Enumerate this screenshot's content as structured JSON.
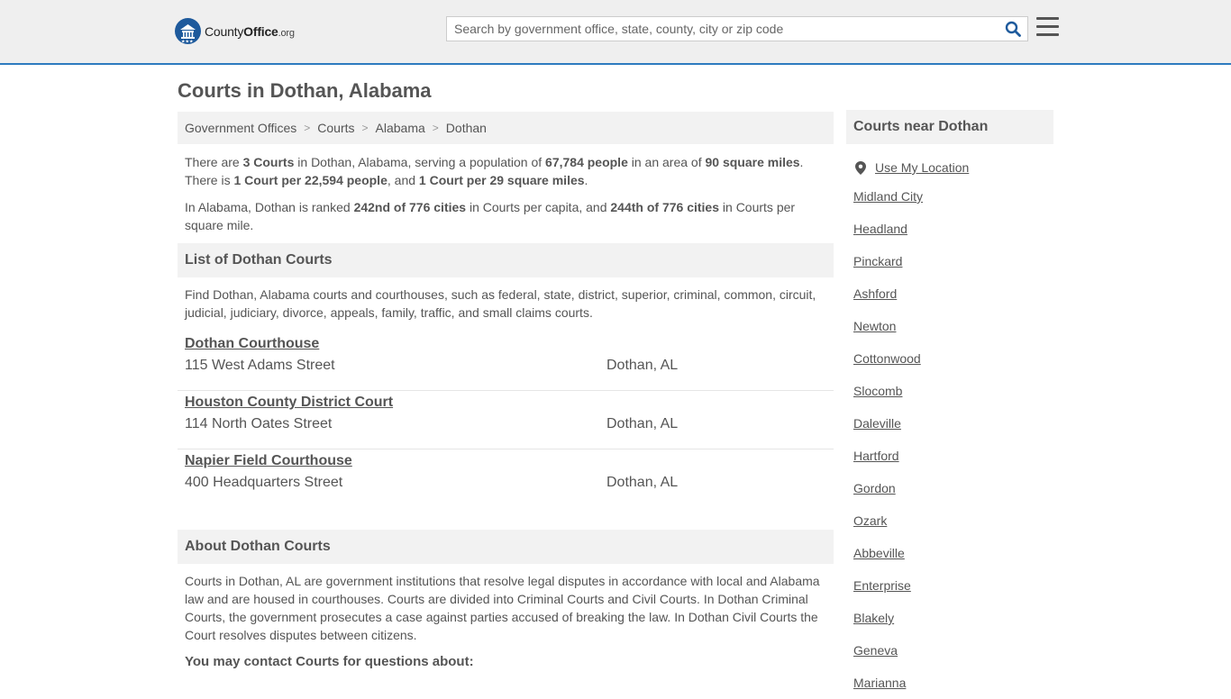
{
  "header": {
    "logo_main": "County",
    "logo_bold": "Office",
    "logo_org": ".org",
    "search_placeholder": "Search by government office, state, county, city or zip code"
  },
  "page": {
    "title": "Courts in Dothan, Alabama"
  },
  "breadcrumb": [
    "Government Offices",
    "Courts",
    "Alabama",
    "Dothan"
  ],
  "intro": {
    "p1_a": "There are ",
    "p1_b": "3 Courts",
    "p1_c": " in Dothan, Alabama, serving a population of ",
    "p1_d": "67,784 people",
    "p1_e": " in an area of ",
    "p1_f": "90 square miles",
    "p1_g": ". There is ",
    "p1_h": "1 Court per 22,594 people",
    "p1_i": ", and ",
    "p1_j": "1 Court per 29 square miles",
    "p1_k": ".",
    "p2_a": "In Alabama, Dothan is ranked ",
    "p2_b": "242nd of 776 cities",
    "p2_c": " in Courts per capita, and ",
    "p2_d": "244th of 776 cities",
    "p2_e": " in Courts per square mile."
  },
  "list_section": {
    "heading": "List of Dothan Courts",
    "description": "Find Dothan, Alabama courts and courthouses, such as federal, state, district, superior, criminal, common, circuit, judicial, judiciary, divorce, appeals, family, traffic, and small claims courts."
  },
  "courts": [
    {
      "name": "Dothan Courthouse",
      "address": "115 West Adams Street",
      "city": "Dothan, AL"
    },
    {
      "name": "Houston County District Court",
      "address": "114 North Oates Street",
      "city": "Dothan, AL"
    },
    {
      "name": "Napier Field Courthouse",
      "address": "400 Headquarters Street",
      "city": "Dothan, AL"
    }
  ],
  "about_section": {
    "heading": "About Dothan Courts",
    "body": "Courts in Dothan, AL are government institutions that resolve legal disputes in accordance with local and Alabama law and are housed in courthouses. Courts are divided into Criminal Courts and Civil Courts. In Dothan Criminal Courts, the government prosecutes a case against parties accused of breaking the law. In Dothan Civil Courts the Court resolves disputes between citizens.",
    "contact_heading": "You may contact Courts for questions about:"
  },
  "sidebar": {
    "heading": "Courts near Dothan",
    "use_location": "Use My Location",
    "cities": [
      "Midland City",
      "Headland",
      "Pinckard",
      "Ashford",
      "Newton",
      "Cottonwood",
      "Slocomb",
      "Daleville",
      "Hartford",
      "Gordon",
      "Ozark",
      "Abbeville",
      "Enterprise",
      "Blakely",
      "Geneva",
      "Marianna"
    ]
  },
  "colors": {
    "brand_blue": "#1e5a9c",
    "accent_line": "#2e7bbf",
    "panel_gray": "#f2f2f2",
    "text": "#555555"
  }
}
